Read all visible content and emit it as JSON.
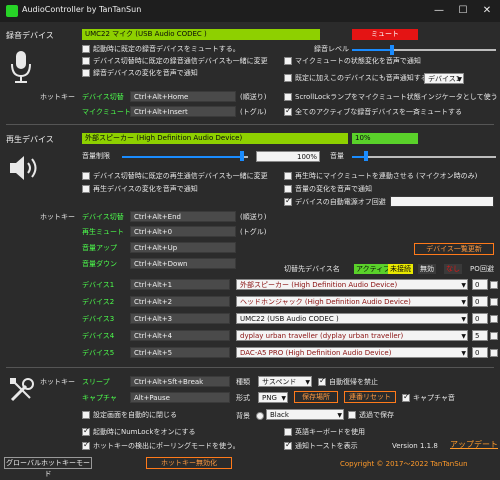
{
  "window": {
    "title": "AudioController by TanTanSun",
    "minimize": "—",
    "maximize": "☐",
    "close": "✕"
  },
  "recording": {
    "section_label": "録音デバイス",
    "device_name": "UMC22 マイク (USB Audio CODEC )",
    "mute_status": "ミュート",
    "level_label": "録音レベル",
    "level": 0.28,
    "options": [
      {
        "label": "起動時に既定の録音デバイスをミュートする。",
        "checked": false
      },
      {
        "label": "デバイス切替時に既定の録音通信デバイスも一緒に変更",
        "checked": false
      },
      {
        "label": "録音デバイスの変化を音声で通知",
        "checked": false
      }
    ],
    "options_right": [
      {
        "label": "マイクミュートの状態変化を音声で通知",
        "checked": false
      },
      {
        "label": "既定に加えこのデバイスにも音声通知する",
        "checked": false
      },
      {
        "label": "ScrollLockランプをマイクミュート状態インジケータとして使う",
        "checked": false
      },
      {
        "label": "全てのアクティブな録音デバイスを一斉ミュートする",
        "checked": true
      }
    ],
    "notify_device": "デバイス1",
    "hotkey_label": "ホットキー",
    "hotkeys": [
      {
        "name": "デバイス切替",
        "key": "Ctrl+Alt+Home",
        "note": "(順送り)"
      },
      {
        "name": "マイクミュート",
        "key": "Ctrl+Alt+Insert",
        "note": "(トグル)"
      }
    ]
  },
  "playback": {
    "section_label": "再生デバイス",
    "device_name": "外部スピーカー (High Definition Audio Device)",
    "volume_percent": "10%",
    "volume_limit_label": "音量制限",
    "volume_limit": 0.95,
    "volume_limit_value": "100%",
    "volume_label": "音量",
    "volume": 0.1,
    "options": [
      {
        "label": "デバイス切替時に既定の再生通信デバイスも一緒に変更",
        "checked": false
      },
      {
        "label": "再生デバイスの変化を音声で通知",
        "checked": false
      }
    ],
    "options_right": [
      {
        "label": "再生時にマイクミュートを連動させる (マイクオン時のみ)",
        "checked": false
      },
      {
        "label": "音量の変化を音声で通知",
        "checked": false
      },
      {
        "label": "デバイスの自動電源オフ回避",
        "checked": true
      }
    ],
    "hotkey_label": "ホットキー",
    "hotkeys": [
      {
        "name": "デバイス切替",
        "key": "Ctrl+Alt+End",
        "note": "(順送り)"
      },
      {
        "name": "再生ミュート",
        "key": "Ctrl+Alt+0",
        "note": "(トグル)"
      },
      {
        "name": "音量アップ",
        "key": "Ctrl+Alt+Up",
        "note": ""
      },
      {
        "name": "音量ダウン",
        "key": "Ctrl+Alt+Down",
        "note": ""
      }
    ],
    "device_list_button": "デバイス一覧更新",
    "target_header": "切替先デバイス名",
    "status_active": "アクティブ",
    "status_unconnected": "未接続",
    "status_disabled": "無効",
    "status_none": "なし",
    "po_label": "PO",
    "loop_label": "回避",
    "devices": [
      {
        "name": "デバイス1",
        "key": "Ctrl+Alt+1",
        "target": "外部スピーカー (High Definition Audio Device)",
        "po": "0"
      },
      {
        "name": "デバイス2",
        "key": "Ctrl+Alt+2",
        "target": "ヘッドホンジャック (High Definition Audio Device)",
        "po": "0"
      },
      {
        "name": "デバイス3",
        "key": "Ctrl+Alt+3",
        "target": "UMC22 (USB Audio CODEC )",
        "po": "0"
      },
      {
        "name": "デバイス4",
        "key": "Ctrl+Alt+4",
        "target": "dyplay urban traveller (dyplay urban traveller)",
        "po": "5"
      },
      {
        "name": "デバイス5",
        "key": "Ctrl+Alt+5",
        "target": "DAC-A5 PRO (High Definition Audio Device)",
        "po": "0"
      }
    ]
  },
  "general": {
    "hotkey_label": "ホットキー",
    "hotkeys": [
      {
        "name": "スリープ",
        "key": "Ctrl+Alt+Sft+Break"
      },
      {
        "name": "キャプチャ",
        "key": "Alt+Pause"
      }
    ],
    "kind_label": "種類",
    "kind_value": "サスペンド",
    "auto_resume": {
      "label": "自動復帰を禁止",
      "checked": true
    },
    "format_label": "形式",
    "format_value": "PNG",
    "save_location_button": "保存場所",
    "serial_reset_button": "連番リセット",
    "capture_sound": {
      "label": "キャプチャ音",
      "checked": true
    },
    "bg_label": "背景",
    "bg_value": "Black",
    "transparent_save": {
      "label": "透過で保存",
      "checked": false
    },
    "options": [
      {
        "label": "設定画面を自動的に閉じる",
        "checked": false
      },
      {
        "label": "起動時にNumLockをオンにする",
        "checked": true
      },
      {
        "label": "ホットキーの検出にポーリングモードを使う。",
        "checked": true
      }
    ],
    "options_right": [
      {
        "label": "英語キーボードを使用",
        "checked": false
      },
      {
        "label": "通知トーストを表示",
        "checked": true
      }
    ],
    "version": "Version 1.1.8",
    "update_link": "アップデート",
    "global_hotkey_mode_button": "グローバルホットキーモード",
    "hotkey_disable_button": "ホットキー無効化",
    "copyright": "Copyright © 2017～2022 TanTanSun"
  },
  "colors": {
    "accent_green": "#4cff4c",
    "device_lime": "#8ed000",
    "mute_red": "#e41414",
    "orange": "#ff7a1a",
    "slider_blue": "#1a8cff"
  }
}
